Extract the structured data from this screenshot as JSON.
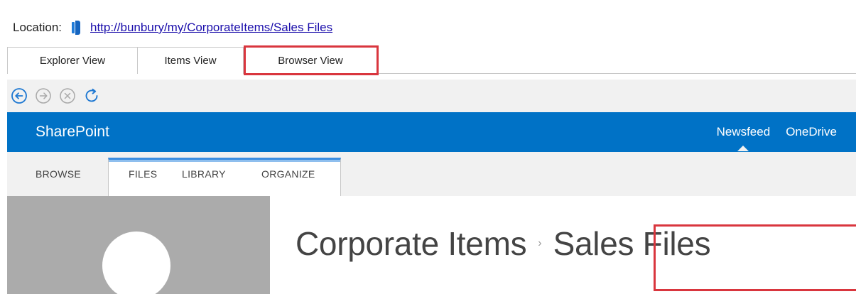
{
  "location": {
    "label": "Location:",
    "url": "http://bunbury/my/CorporateItems/Sales Files"
  },
  "view_tabs": [
    {
      "label": "Explorer View",
      "selected": false
    },
    {
      "label": "Items View",
      "selected": false
    },
    {
      "label": "Browser View",
      "selected": true
    }
  ],
  "toolbar": {
    "buttons": [
      "back-icon",
      "forward-icon",
      "stop-icon",
      "refresh-icon"
    ]
  },
  "suite_bar": {
    "brand": "SharePoint",
    "links": [
      "Newsfeed",
      "OneDrive"
    ]
  },
  "ribbon": {
    "tabs": [
      "BROWSE",
      "FILES",
      "LIBRARY",
      "ORGANIZE"
    ]
  },
  "page": {
    "breadcrumb": [
      "Corporate Items",
      "Sales Files"
    ],
    "separator": "›"
  },
  "colors": {
    "suite_bar": "#0072c6",
    "highlight": "#d9363e",
    "link": "#1a0dab",
    "logo_placeholder": "#ababab"
  }
}
